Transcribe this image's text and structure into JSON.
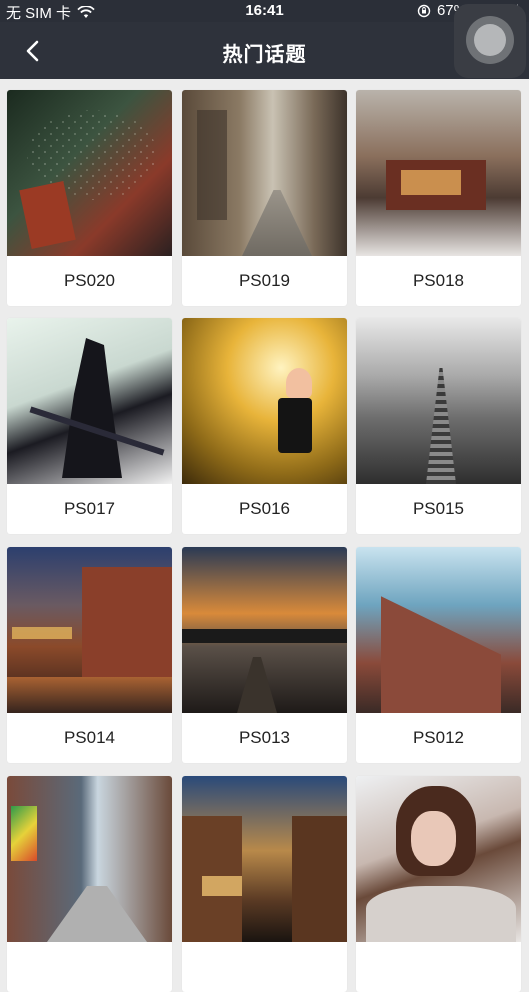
{
  "status_bar": {
    "carrier": "无 SIM 卡",
    "time": "16:41",
    "battery_percent": "67%",
    "battery_level": 0.67,
    "icons": [
      "wifi-icon",
      "rotation-lock-icon",
      "battery-icon",
      "charging-icon"
    ]
  },
  "nav": {
    "title": "热门话题",
    "back_icon": "chevron-left-icon",
    "background": "#2e323b"
  },
  "topics": [
    {
      "label": "PS020"
    },
    {
      "label": "PS019"
    },
    {
      "label": "PS018"
    },
    {
      "label": "PS017"
    },
    {
      "label": "PS016"
    },
    {
      "label": "PS015"
    },
    {
      "label": "PS014"
    },
    {
      "label": "PS013"
    },
    {
      "label": "PS012"
    },
    {
      "label": ""
    },
    {
      "label": ""
    },
    {
      "label": ""
    }
  ],
  "colors": {
    "page_background": "#ececec",
    "card_background": "#ffffff",
    "battery_green": "#4cd964"
  }
}
